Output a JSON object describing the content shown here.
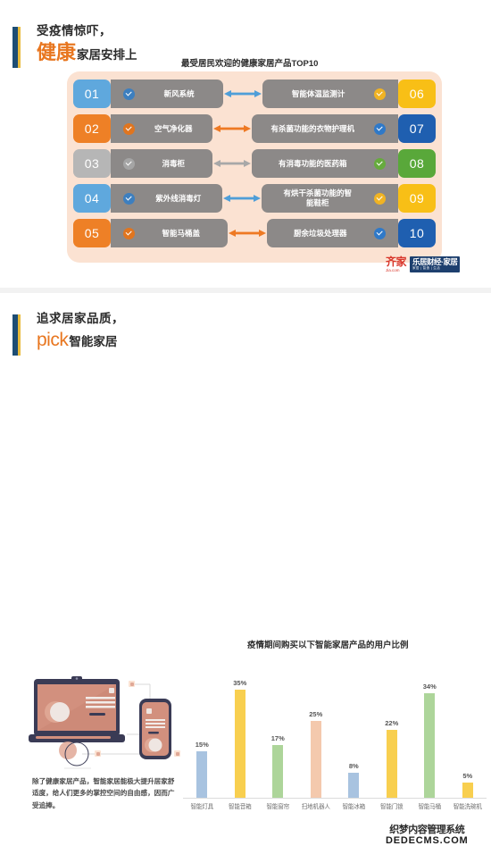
{
  "sections": {
    "top": {
      "heading": {
        "line1": "受疫情惊吓，",
        "accent": "健康",
        "rest": "家居安排上"
      },
      "chart_title": "最受居民欢迎的健康家居产品TOP10",
      "rows": [
        {
          "left_rank": "01",
          "left_label": "新风系统",
          "left_rank_color": "#5fa8dd",
          "left_check_color": "#3d7fbf",
          "arrow_color": "#4f9ed8",
          "right_label": "智能体温监测计",
          "right_check_color": "#f0b323",
          "right_rank": "06",
          "right_rank_color": "#f8bf16"
        },
        {
          "left_rank": "02",
          "left_label": "空气净化器",
          "left_rank_color": "#ee8026",
          "left_check_color": "#e0751f",
          "arrow_color": "#ee7923",
          "right_label": "有杀菌功能的衣物护理机",
          "right_check_color": "#2f79c8",
          "right_rank": "07",
          "right_rank_color": "#1f5fb0"
        },
        {
          "left_rank": "03",
          "left_label": "消毒柜",
          "left_rank_color": "#b6b6b6",
          "left_check_color": "#a5a5a5",
          "arrow_color": "#a8a8a8",
          "right_label": "有消毒功能的医药箱",
          "right_check_color": "#66ab3d",
          "right_rank": "08",
          "right_rank_color": "#59a83a"
        },
        {
          "left_rank": "04",
          "left_label": "紫外线消毒灯",
          "left_rank_color": "#5fa8dd",
          "left_check_color": "#3d7fbf",
          "arrow_color": "#4f9ed8",
          "right_label": "有烘干杀菌功能的智能鞋柜",
          "right_check_color": "#f0b323",
          "right_rank": "09",
          "right_rank_color": "#f8bf16"
        },
        {
          "left_rank": "05",
          "left_label": "智能马桶盖",
          "left_rank_color": "#ee8026",
          "left_check_color": "#e0751f",
          "arrow_color": "#ee7923",
          "right_label": "厨余垃圾处理器",
          "right_check_color": "#2f79c8",
          "right_rank": "10",
          "right_rank_color": "#1f5fb0"
        }
      ],
      "logo": {
        "brand": "齐家",
        "brand_sub": "Jia.com",
        "badge_main": "乐居财经·家居",
        "badge_sub": "家居 | 智造 | 生活"
      }
    },
    "bottom": {
      "heading": {
        "line1": "追求居家品质，",
        "accent": "pick",
        "rest": "智能家居"
      },
      "caption": "除了健康家居产品，智能家居能极大提升居家舒适度，给人们更多的掌控空间的自由感，因而广受追捧。",
      "illustration_name": "laptop-and-phone-illustration"
    }
  },
  "chart_data": {
    "type": "bar",
    "title": "疫情期间购买以下智能家居产品的用户比例",
    "xlabel": "",
    "ylabel": "",
    "ylim": [
      0,
      40
    ],
    "grid": false,
    "legend": "none",
    "categories": [
      "智能灯具",
      "智能音箱",
      "智能窗帘",
      "扫地机器人",
      "智能冰箱",
      "智能门锁",
      "智能马桶",
      "智能洗碗机"
    ],
    "values": [
      15,
      35,
      17,
      25,
      8,
      22,
      34,
      5
    ],
    "value_labels": [
      "15%",
      "35%",
      "17%",
      "25%",
      "8%",
      "22%",
      "34%",
      "5%"
    ],
    "bar_colors": [
      "#a8c3e0",
      "#f8cf4f",
      "#add59a",
      "#f4c9ad",
      "#a8c3e0",
      "#f8cf4f",
      "#add59a",
      "#f8cf4f"
    ]
  },
  "watermark": {
    "cn": "织梦内容管理系统",
    "en": "DEDECMS.COM"
  }
}
